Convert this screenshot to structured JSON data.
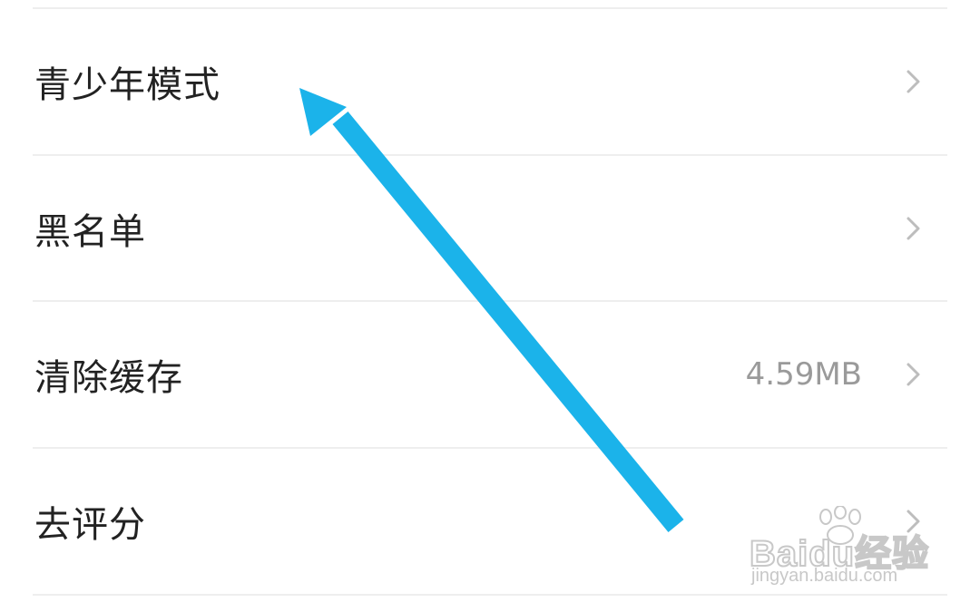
{
  "settings": {
    "items": [
      {
        "label": "青少年模式",
        "value": ""
      },
      {
        "label": "黑名单",
        "value": ""
      },
      {
        "label": "清除缓存",
        "value": "4.59MB"
      },
      {
        "label": "去评分",
        "value": ""
      }
    ]
  },
  "annotation": {
    "arrow_color": "#1BB3EA"
  },
  "watermark": {
    "main": "Bai",
    "main_suffix": "du",
    "cn": "经验",
    "sub": "jingyan.baidu.com"
  },
  "colors": {
    "label": "#222222",
    "value": "#9a9a9a",
    "chevron": "#bdbdbd",
    "divider": "#eeeeee"
  }
}
